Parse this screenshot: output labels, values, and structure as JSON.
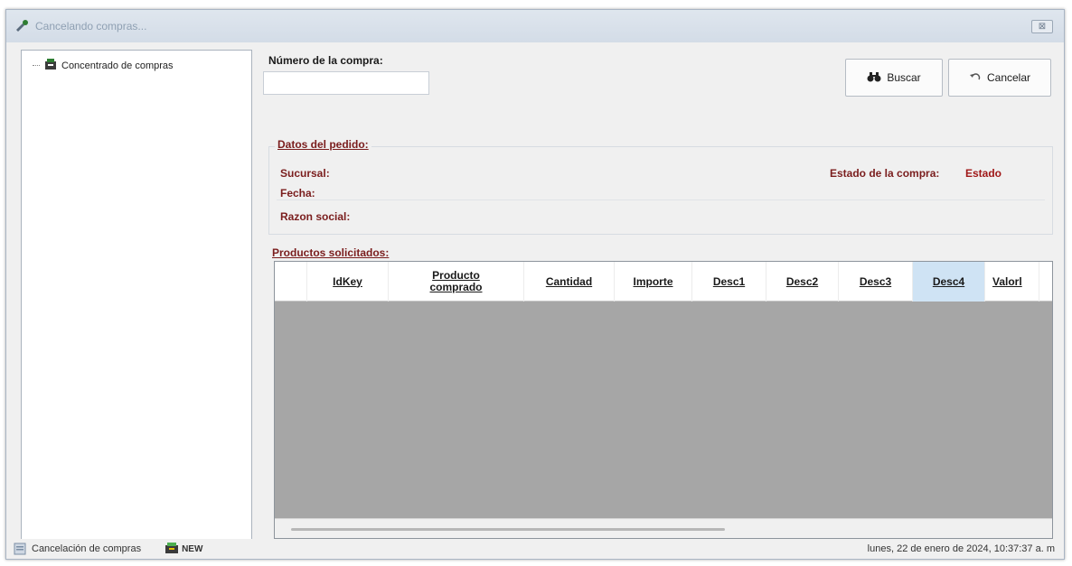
{
  "window": {
    "title": "Cancelando compras...",
    "close_glyph": "⊠"
  },
  "tree": {
    "items": [
      {
        "label": "Concentrado de compras",
        "icon": "purchases-tree-icon"
      }
    ]
  },
  "form": {
    "numero_label": "Número de la compra:",
    "numero_value": "",
    "buscar_label": "Buscar",
    "cancelar_label": "Cancelar"
  },
  "pedido": {
    "group_title": "Datos del pedido:",
    "sucursal_label": "Sucursal:",
    "fecha_label": "Fecha:",
    "razon_label": "Razon social:",
    "estado_label": "Estado de la compra:",
    "estado_value": "Estado"
  },
  "productos": {
    "group_title": "Productos solicitados:",
    "columns": [
      "IdKey",
      "Producto\ncomprado",
      "Cantidad",
      "Importe",
      "Desc1",
      "Desc2",
      "Desc3",
      "Desc4",
      "Valorl"
    ],
    "highlighted_column": "Desc4"
  },
  "status": {
    "text": "Cancelación de compras",
    "new_label": "NEW",
    "datetime": "lunes, 22 de enero de 2024, 10:37:37 a. m"
  },
  "colors": {
    "accent_label": "#7a1d1d",
    "estado_value": "#a01818",
    "grid_empty": "#a6a6a6",
    "header_highlight": "#cfe3f4"
  }
}
